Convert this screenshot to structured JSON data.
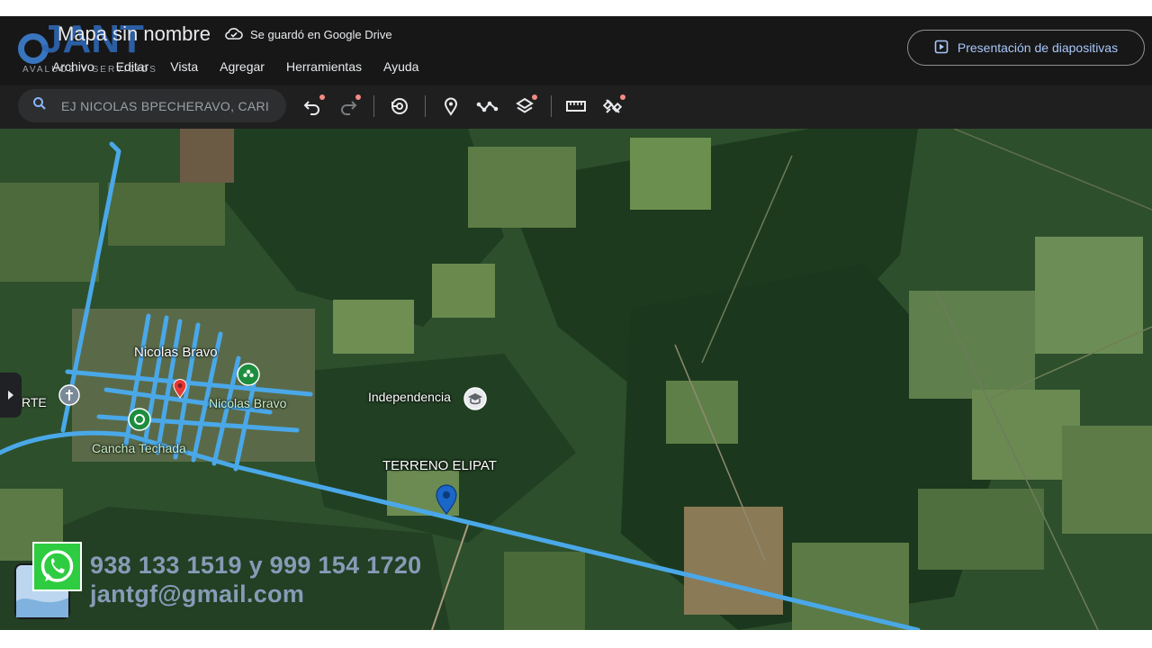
{
  "header": {
    "doc_title": "Mapa sin nombre",
    "drive_status": "Se guardó en Google Drive",
    "slideshow_label": "Presentación de diapositivas"
  },
  "menu": {
    "items": [
      "Archivo",
      "Editar",
      "Vista",
      "Agregar",
      "Herramientas",
      "Ayuda"
    ]
  },
  "search": {
    "placeholder": "EJ NICOLAS BPECHERAVO, CARI"
  },
  "watermark": {
    "brand": "JANT",
    "tagline": "AVALUOS Y SERVICIOS"
  },
  "map": {
    "labels": {
      "village": "Nicolas Bravo",
      "village_poi": "Nicolas Bravo",
      "court": "Cancha Techada",
      "school": "Independencia",
      "terrain": "TERRENO ELIPAT",
      "edge": "RTE"
    }
  },
  "contact": {
    "phones": "938 133 1519 y 999 154 1720",
    "email": "jantgf@gmail.com"
  },
  "colors": {
    "route": "#4aa8e8",
    "accent": "#a8c7fa",
    "pin_blue": "#1a66c9",
    "pin_red": "#e53935",
    "poi_green": "#1e8e3e"
  }
}
